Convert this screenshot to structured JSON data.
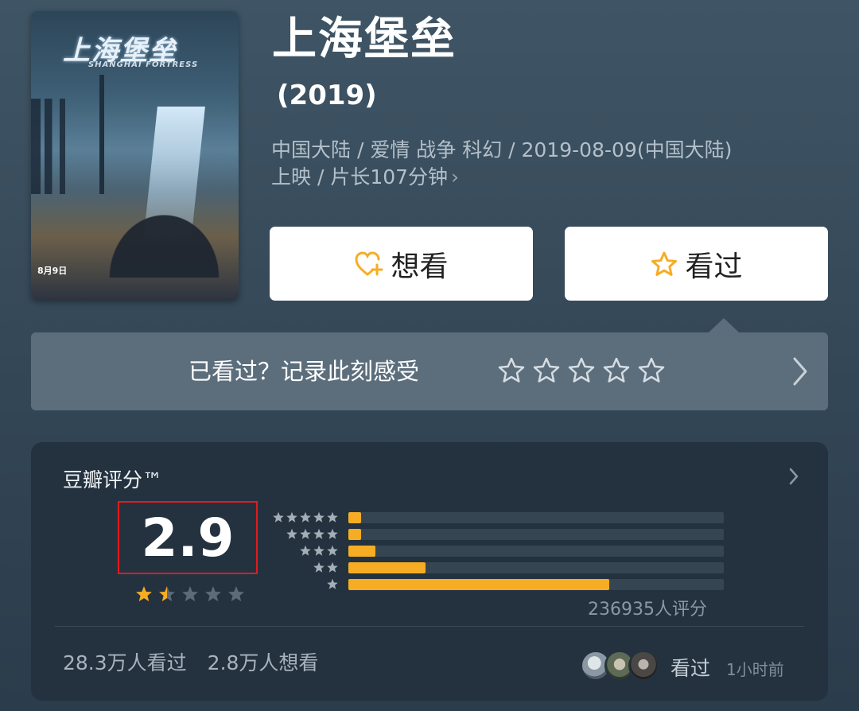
{
  "movie": {
    "title": "上海堡垒",
    "year": "(2019)",
    "meta_line1": "中国大陆 / 爱情 战争 科幻 / 2019-08-09(中国大陆)",
    "meta_line2": "上映 / 片长107分钟",
    "meta_chevron": "›",
    "poster": {
      "title_art": "上海堡垒",
      "subtitle_art": "SHANGHAI FORTRESS",
      "date_art": "8月9日"
    }
  },
  "actions": {
    "want_label": "想看",
    "want_icon": "heart-plus-icon",
    "seen_label": "看过",
    "seen_icon": "star-outline-icon",
    "accent": "#f7ad23"
  },
  "rate_prompt": {
    "text": "已看过？记录此刻感受",
    "star_count": 5
  },
  "rating": {
    "header": "豆瓣评分™",
    "score": "2.9",
    "score_stars": 1.5,
    "distribution": [
      {
        "stars": 5,
        "percent": 3.4
      },
      {
        "stars": 4,
        "percent": 3.4
      },
      {
        "stars": 3,
        "percent": 7.2
      },
      {
        "stars": 2,
        "percent": 20.5
      },
      {
        "stars": 1,
        "percent": 69.5
      }
    ],
    "count_text": "236935人评分",
    "watched_text": "28.3万人看过",
    "wish_text": "2.8万人想看",
    "friend_action": "看过",
    "friend_time": "1小时前",
    "bar_color": "#f7ad23",
    "highlight_color": "#e21b1b"
  }
}
